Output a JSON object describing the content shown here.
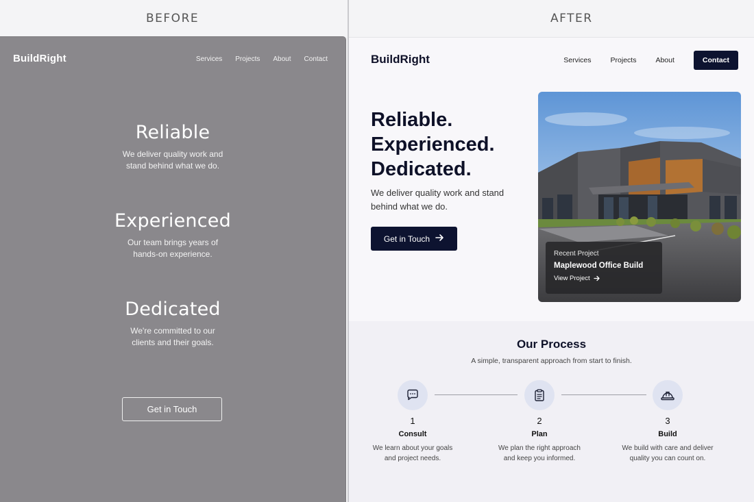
{
  "labels": {
    "before": "BEFORE",
    "after": "AFTER"
  },
  "before": {
    "logo": "BuildRight",
    "nav": [
      "Services",
      "Projects",
      "About",
      "Contact"
    ],
    "blocks": [
      {
        "title": "Reliable",
        "line1": "We deliver quality work and",
        "line2": "stand behind what we do."
      },
      {
        "title": "Experienced",
        "line1": "Our team brings years of",
        "line2": "hands-on experience."
      },
      {
        "title": "Dedicated",
        "line1": "We're committed to our",
        "line2": "clients and their goals."
      }
    ],
    "cta": "Get in Touch",
    "colors": {
      "background": "#8a888c",
      "text": "#ffffff"
    }
  },
  "after": {
    "logo": "BuildRight",
    "nav": [
      "Services",
      "Projects",
      "About"
    ],
    "contact_button": "Contact",
    "headline": [
      "Reliable.",
      "Experienced.",
      "Dedicated."
    ],
    "subtext": "We deliver quality work and stand behind what we do.",
    "cta": "Get in Touch",
    "project_card": {
      "eyebrow": "Recent Project",
      "name": "Maplewood Office Build",
      "link": "View Project"
    },
    "process": {
      "title": "Our Process",
      "subtitle": "A simple, transparent approach from start to finish.",
      "steps": [
        {
          "num": "1",
          "name": "Consult",
          "line1": "We learn about your goals",
          "line2": "and project needs.",
          "icon": "chat-bubble-icon"
        },
        {
          "num": "2",
          "name": "Plan",
          "line1": "We plan the right approach",
          "line2": "and keep you informed.",
          "icon": "clipboard-icon"
        },
        {
          "num": "3",
          "name": "Build",
          "line1": "We build with care and deliver",
          "line2": "quality you can count on.",
          "icon": "hard-hat-icon"
        }
      ]
    },
    "colors": {
      "primary": "#0d1330",
      "background": "#f8f7fa",
      "icon_circle": "#dfe3f1"
    }
  }
}
